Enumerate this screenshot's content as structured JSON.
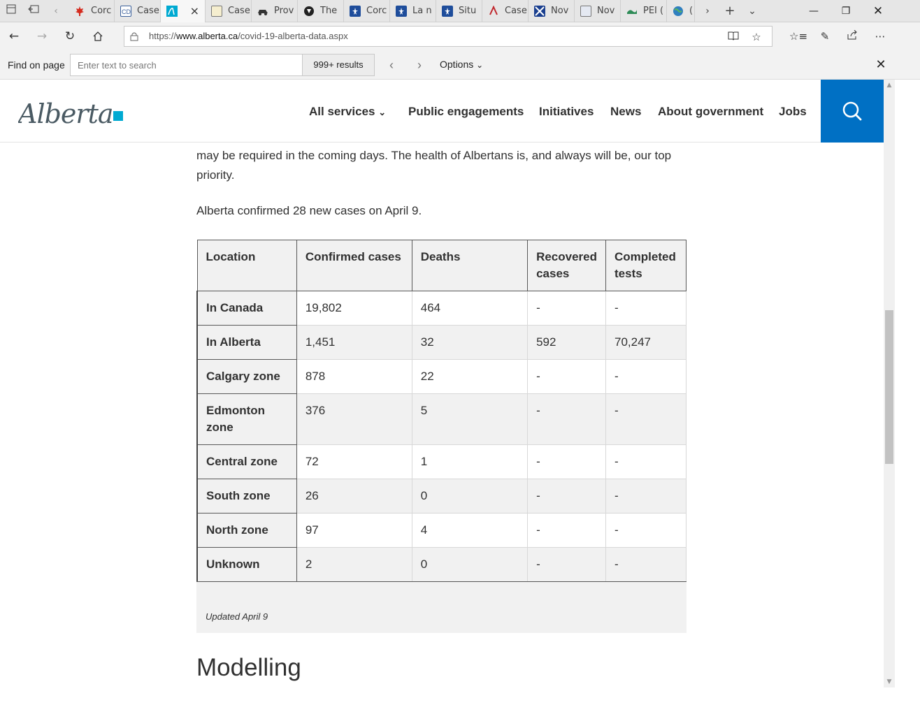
{
  "browser": {
    "tabs": [
      {
        "label": "Corc",
        "icon": "maple-leaf-icon"
      },
      {
        "label": "Case",
        "icon": "cc-icon"
      },
      {
        "label": "",
        "icon": "alberta-icon",
        "active": true
      },
      {
        "label": "Case",
        "icon": "case-icon"
      },
      {
        "label": "Prov",
        "icon": "car-icon"
      },
      {
        "label": "The",
        "icon": "shield-icon"
      },
      {
        "label": "Corc",
        "icon": "quebec-icon"
      },
      {
        "label": "La n",
        "icon": "quebec-icon"
      },
      {
        "label": "Situ",
        "icon": "quebec-icon"
      },
      {
        "label": "Case",
        "icon": "case-icon"
      },
      {
        "label": "Nov",
        "icon": "ns-icon"
      },
      {
        "label": "Nov",
        "icon": "nb-icon"
      },
      {
        "label": "PEI (",
        "icon": "pei-icon"
      },
      {
        "label": "(",
        "icon": "globe-icon"
      }
    ],
    "url_prefix": "https://",
    "url_host": "www.alberta.ca",
    "url_path": "/covid-19-alberta-data.aspx"
  },
  "find": {
    "label": "Find on page",
    "placeholder": "Enter text to search",
    "results": "999+ results",
    "options": "Options"
  },
  "site": {
    "logo_text": "Alberta",
    "nav": {
      "all_services": "All services",
      "public_engagements": "Public engagements",
      "initiatives": "Initiatives",
      "news": "News",
      "about_government": "About government",
      "jobs": "Jobs"
    },
    "accent_color": "#0070c4",
    "logo_accent": "#00aad2"
  },
  "content": {
    "para_1": "may be required in the coming days. The health of Albertans is, and always will be, our top priority.",
    "para_2": "Alberta confirmed 28 new cases on April 9.",
    "table": {
      "headers": [
        "Location",
        "Confirmed cases",
        "Deaths",
        "Recovered cases",
        "Completed tests"
      ],
      "rows": [
        [
          "In Canada",
          "19,802",
          "464",
          "-",
          "-"
        ],
        [
          "In Alberta",
          "1,451",
          "32",
          "592",
          "70,247"
        ],
        [
          "Calgary zone",
          "878",
          "22",
          "-",
          "-"
        ],
        [
          "Edmonton zone",
          "376",
          "5",
          "-",
          "-"
        ],
        [
          "Central zone",
          "72",
          "1",
          "-",
          "-"
        ],
        [
          "South zone",
          "26",
          "0",
          "-",
          "-"
        ],
        [
          "North zone",
          "97",
          "4",
          "-",
          "-"
        ],
        [
          "Unknown",
          "2",
          "0",
          "-",
          "-"
        ]
      ]
    },
    "updated": "Updated April 9",
    "modelling_heading": "Modelling"
  }
}
